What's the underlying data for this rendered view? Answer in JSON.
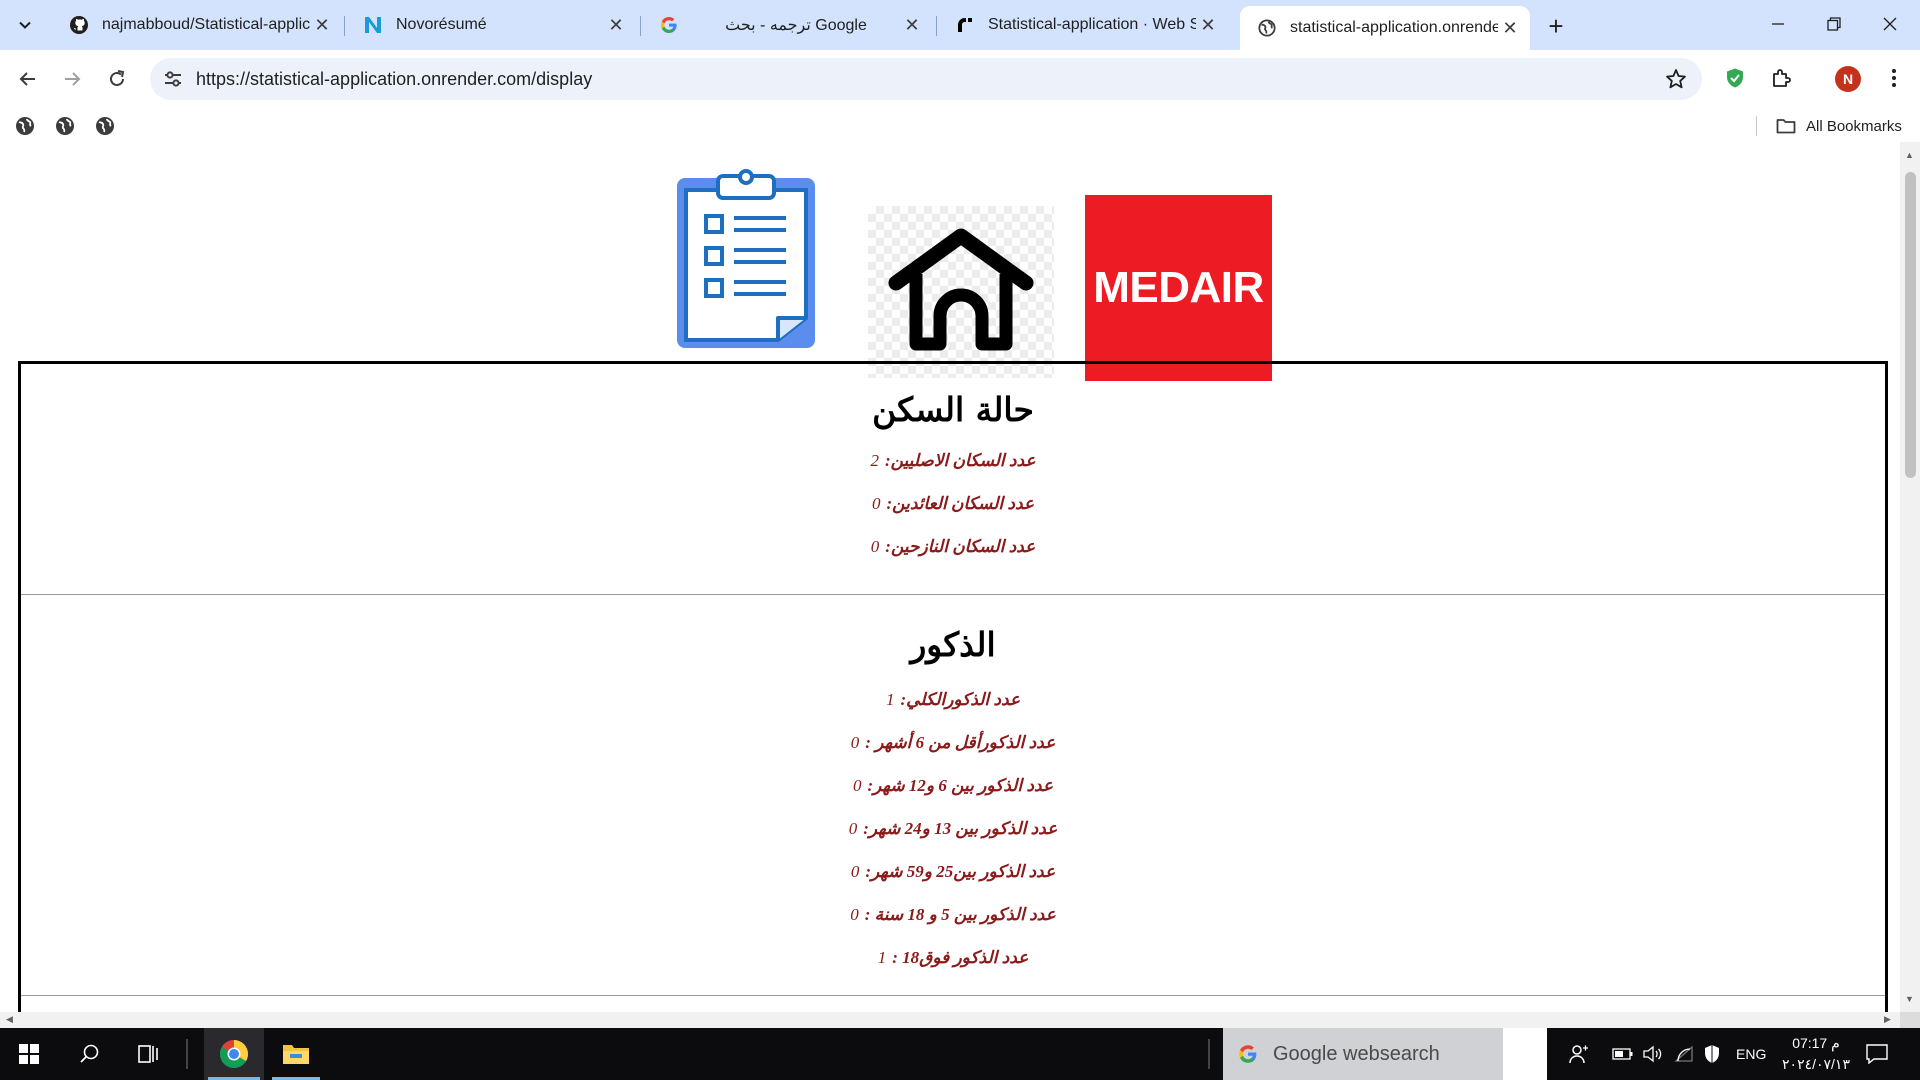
{
  "browser": {
    "tabs": [
      {
        "title": "najmabboud/Statistical-applicat",
        "icon": "github-icon",
        "active": false
      },
      {
        "title": "Novorésumé",
        "icon": "novoresume-icon",
        "active": false
      },
      {
        "title": "ترجمه - بحث Google",
        "icon": "google-icon",
        "active": false
      },
      {
        "title": "Statistical-application · Web Se",
        "icon": "render-icon",
        "active": false
      },
      {
        "title": "statistical-application.onrender.",
        "icon": "globe-icon",
        "active": true
      }
    ],
    "url": "https://statistical-application.onrender.com/display",
    "profile_initial": "N",
    "bookmarks_all_label": "All Bookmarks"
  },
  "page": {
    "logos": {
      "clipboard": "clipboard-icon",
      "house": "house-icon",
      "medair_text": "MEDAIR",
      "medair_color": "#ed1c24"
    },
    "sections": [
      {
        "title": "حالة السكن",
        "lines": [
          {
            "label": "عدد السكان الاصليين:",
            "value": "2"
          },
          {
            "label": "عدد السكان العائدين:",
            "value": "0"
          },
          {
            "label": "عدد السكان النازحين:",
            "value": "0"
          }
        ]
      },
      {
        "title": "الذكور",
        "lines": [
          {
            "label": "عدد الذكورالكلي:",
            "value": "1"
          },
          {
            "label": "عدد الذكورأقل من 6 أشهر :",
            "value": "0"
          },
          {
            "label": "عدد الذكور بين 6 و12 شهر:",
            "value": "0"
          },
          {
            "label": "عدد الذكور بين 13 و24 شهر:",
            "value": "0"
          },
          {
            "label": "عدد الذكور بين25 و59 شهر:",
            "value": "0"
          },
          {
            "label": "عدد الذكور بين 5 و 18 سنة :",
            "value": "0"
          },
          {
            "label": "عدد الذكور فوق18 :",
            "value": "1"
          }
        ]
      }
    ],
    "text_color": "#8b1a1a"
  },
  "taskbar": {
    "search_text": "Google websearch",
    "language": "ENG",
    "time": "07:17 م",
    "date": "٢٠٢٤/٠٧/١٣"
  }
}
